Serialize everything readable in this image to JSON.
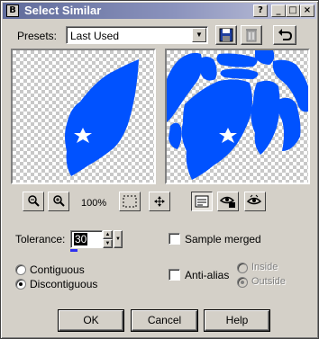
{
  "window": {
    "title": "Select Similar",
    "icon": "app-icon-b"
  },
  "titlebar": {
    "help": "?",
    "minimize": "_",
    "maximize": "□",
    "close": "×"
  },
  "presets": {
    "label": "Presets:",
    "value": "Last Used",
    "icons": [
      "save-preset-icon",
      "delete-preset-icon",
      "reset-icon"
    ]
  },
  "preview_toolbar": {
    "zoom_level": "100%",
    "buttons": [
      "zoom-out-icon",
      "zoom-in-icon",
      "select-area-icon",
      "pan-icon",
      "proof-icon",
      "lock-preview-icon",
      "auto-proof-icon"
    ]
  },
  "tolerance": {
    "label": "Tolerance:",
    "value": "30"
  },
  "options": {
    "sample_merged": "Sample merged",
    "contiguous": "Contiguous",
    "discontiguous": "Discontiguous",
    "selected_mode": "Discontiguous",
    "anti_alias": "Anti-alias",
    "inside": "Inside",
    "outside": "Outside",
    "selected_alias": "Outside"
  },
  "buttons": {
    "ok": "OK",
    "cancel": "Cancel",
    "help": "Help"
  },
  "colors": {
    "selection_blue": "#0052ff",
    "title_start": "#5f6b9a",
    "dialog_bg": "#d4d0c8"
  }
}
